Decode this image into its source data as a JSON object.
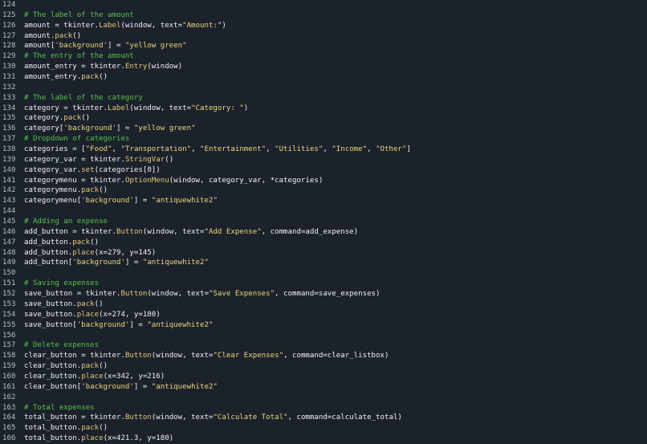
{
  "editor": {
    "theme_colors": {
      "background": "#1b222c",
      "line_number": "#b9bec7",
      "comment": "#58c24a",
      "string": "#f0d77a",
      "function": "#e7c777",
      "text": "#f2f2f2"
    },
    "lines": [
      {
        "n": "124",
        "tokens": []
      },
      {
        "n": "125",
        "tokens": [
          {
            "t": "c",
            "v": "# The label of the amount"
          }
        ]
      },
      {
        "n": "126",
        "tokens": [
          {
            "t": "p",
            "v": "amount = tkinter."
          },
          {
            "t": "f",
            "v": "Label"
          },
          {
            "t": "p",
            "v": "(window, text="
          },
          {
            "t": "s",
            "v": "\"Amount:\""
          },
          {
            "t": "p",
            "v": ")"
          }
        ]
      },
      {
        "n": "127",
        "tokens": [
          {
            "t": "p",
            "v": "amount."
          },
          {
            "t": "f",
            "v": "pack"
          },
          {
            "t": "p",
            "v": "()"
          }
        ]
      },
      {
        "n": "128",
        "tokens": [
          {
            "t": "p",
            "v": "amount["
          },
          {
            "t": "s",
            "v": "'background'"
          },
          {
            "t": "p",
            "v": "] = "
          },
          {
            "t": "s",
            "v": "\"yellow green\""
          }
        ]
      },
      {
        "n": "129",
        "tokens": [
          {
            "t": "c",
            "v": "# The entry of the amount"
          }
        ]
      },
      {
        "n": "130",
        "tokens": [
          {
            "t": "p",
            "v": "amount_entry = tkinter."
          },
          {
            "t": "f",
            "v": "Entry"
          },
          {
            "t": "p",
            "v": "(window)"
          }
        ]
      },
      {
        "n": "131",
        "tokens": [
          {
            "t": "p",
            "v": "amount_entry."
          },
          {
            "t": "f",
            "v": "pack"
          },
          {
            "t": "p",
            "v": "()"
          }
        ]
      },
      {
        "n": "132",
        "tokens": []
      },
      {
        "n": "133",
        "tokens": [
          {
            "t": "c",
            "v": "# The label of the category"
          }
        ]
      },
      {
        "n": "134",
        "tokens": [
          {
            "t": "p",
            "v": "category = tkinter."
          },
          {
            "t": "f",
            "v": "Label"
          },
          {
            "t": "p",
            "v": "(window, text="
          },
          {
            "t": "s",
            "v": "\"Category: \""
          },
          {
            "t": "p",
            "v": ")"
          }
        ]
      },
      {
        "n": "135",
        "tokens": [
          {
            "t": "p",
            "v": "category."
          },
          {
            "t": "f",
            "v": "pack"
          },
          {
            "t": "p",
            "v": "()"
          }
        ]
      },
      {
        "n": "136",
        "tokens": [
          {
            "t": "p",
            "v": "category["
          },
          {
            "t": "s",
            "v": "'background'"
          },
          {
            "t": "p",
            "v": "] = "
          },
          {
            "t": "s",
            "v": "\"yellow green\""
          }
        ]
      },
      {
        "n": "137",
        "tokens": [
          {
            "t": "c",
            "v": "# Dropdown of categories"
          }
        ]
      },
      {
        "n": "138",
        "tokens": [
          {
            "t": "p",
            "v": "categories = ["
          },
          {
            "t": "s",
            "v": "\"Food\""
          },
          {
            "t": "p",
            "v": ", "
          },
          {
            "t": "s",
            "v": "\"Transportation\""
          },
          {
            "t": "p",
            "v": ", "
          },
          {
            "t": "s",
            "v": "\"Entertainment\""
          },
          {
            "t": "p",
            "v": ", "
          },
          {
            "t": "s",
            "v": "\"Utilities\""
          },
          {
            "t": "p",
            "v": ", "
          },
          {
            "t": "s",
            "v": "\"Income\""
          },
          {
            "t": "p",
            "v": ", "
          },
          {
            "t": "s",
            "v": "\"Other\""
          },
          {
            "t": "p",
            "v": "]"
          }
        ]
      },
      {
        "n": "139",
        "tokens": [
          {
            "t": "p",
            "v": "category_var = tkinter."
          },
          {
            "t": "f",
            "v": "StringVar"
          },
          {
            "t": "p",
            "v": "()"
          }
        ]
      },
      {
        "n": "140",
        "tokens": [
          {
            "t": "p",
            "v": "category_var."
          },
          {
            "t": "f",
            "v": "set"
          },
          {
            "t": "p",
            "v": "(categories[0])"
          }
        ]
      },
      {
        "n": "141",
        "tokens": [
          {
            "t": "p",
            "v": "categorymenu = tkinter."
          },
          {
            "t": "f",
            "v": "OptionMenu"
          },
          {
            "t": "p",
            "v": "(window, category_var, *categories)"
          }
        ]
      },
      {
        "n": "142",
        "tokens": [
          {
            "t": "p",
            "v": "categorymenu."
          },
          {
            "t": "f",
            "v": "pack"
          },
          {
            "t": "p",
            "v": "()"
          }
        ]
      },
      {
        "n": "143",
        "tokens": [
          {
            "t": "p",
            "v": "categorymenu["
          },
          {
            "t": "s",
            "v": "'background'"
          },
          {
            "t": "p",
            "v": "] = "
          },
          {
            "t": "s",
            "v": "\"antiquewhite2\""
          }
        ]
      },
      {
        "n": "144",
        "tokens": []
      },
      {
        "n": "145",
        "tokens": [
          {
            "t": "c",
            "v": "# Adding an expense"
          }
        ]
      },
      {
        "n": "146",
        "tokens": [
          {
            "t": "p",
            "v": "add_button = tkinter."
          },
          {
            "t": "f",
            "v": "Button"
          },
          {
            "t": "p",
            "v": "(window, text="
          },
          {
            "t": "s",
            "v": "\"Add Expense\""
          },
          {
            "t": "p",
            "v": ", command=add_expense)"
          }
        ]
      },
      {
        "n": "147",
        "tokens": [
          {
            "t": "p",
            "v": "add_button."
          },
          {
            "t": "f",
            "v": "pack"
          },
          {
            "t": "p",
            "v": "()"
          }
        ]
      },
      {
        "n": "148",
        "tokens": [
          {
            "t": "p",
            "v": "add_button."
          },
          {
            "t": "f",
            "v": "place"
          },
          {
            "t": "p",
            "v": "(x=279, y=145)"
          }
        ]
      },
      {
        "n": "149",
        "tokens": [
          {
            "t": "p",
            "v": "add_button["
          },
          {
            "t": "s",
            "v": "'background'"
          },
          {
            "t": "p",
            "v": "] = "
          },
          {
            "t": "s",
            "v": "\"antiquewhite2\""
          }
        ]
      },
      {
        "n": "150",
        "tokens": []
      },
      {
        "n": "151",
        "tokens": [
          {
            "t": "c",
            "v": "# Saving expenses"
          }
        ]
      },
      {
        "n": "152",
        "tokens": [
          {
            "t": "p",
            "v": "save_button = tkinter."
          },
          {
            "t": "f",
            "v": "Button"
          },
          {
            "t": "p",
            "v": "(window, text="
          },
          {
            "t": "s",
            "v": "\"Save Expenses\""
          },
          {
            "t": "p",
            "v": ", command=save_expenses)"
          }
        ]
      },
      {
        "n": "153",
        "tokens": [
          {
            "t": "p",
            "v": "save_button."
          },
          {
            "t": "f",
            "v": "pack"
          },
          {
            "t": "p",
            "v": "()"
          }
        ]
      },
      {
        "n": "154",
        "tokens": [
          {
            "t": "p",
            "v": "save_button."
          },
          {
            "t": "f",
            "v": "place"
          },
          {
            "t": "p",
            "v": "(x=274, y=180)"
          }
        ]
      },
      {
        "n": "155",
        "tokens": [
          {
            "t": "p",
            "v": "save_button["
          },
          {
            "t": "s",
            "v": "'background'"
          },
          {
            "t": "p",
            "v": "] = "
          },
          {
            "t": "s",
            "v": "\"antiquewhite2\""
          }
        ]
      },
      {
        "n": "156",
        "tokens": []
      },
      {
        "n": "157",
        "tokens": [
          {
            "t": "c",
            "v": "# Delete expenses"
          }
        ]
      },
      {
        "n": "158",
        "tokens": [
          {
            "t": "p",
            "v": "clear_button = tkinter."
          },
          {
            "t": "f",
            "v": "Button"
          },
          {
            "t": "p",
            "v": "(window, text="
          },
          {
            "t": "s",
            "v": "\"Clear Expenses\""
          },
          {
            "t": "p",
            "v": ", command=clear_listbox)"
          }
        ]
      },
      {
        "n": "159",
        "tokens": [
          {
            "t": "p",
            "v": "clear_button."
          },
          {
            "t": "f",
            "v": "pack"
          },
          {
            "t": "p",
            "v": "()"
          }
        ]
      },
      {
        "n": "160",
        "tokens": [
          {
            "t": "p",
            "v": "clear_button."
          },
          {
            "t": "f",
            "v": "place"
          },
          {
            "t": "p",
            "v": "(x=342, y=216)"
          }
        ]
      },
      {
        "n": "161",
        "tokens": [
          {
            "t": "p",
            "v": "clear_button["
          },
          {
            "t": "s",
            "v": "'background'"
          },
          {
            "t": "p",
            "v": "] = "
          },
          {
            "t": "s",
            "v": "\"antiquewhite2\""
          }
        ]
      },
      {
        "n": "162",
        "tokens": []
      },
      {
        "n": "163",
        "tokens": [
          {
            "t": "c",
            "v": "# Total expenses"
          }
        ]
      },
      {
        "n": "164",
        "tokens": [
          {
            "t": "p",
            "v": "total_button = tkinter."
          },
          {
            "t": "f",
            "v": "Button"
          },
          {
            "t": "p",
            "v": "(window, text="
          },
          {
            "t": "s",
            "v": "\"Calculate Total\""
          },
          {
            "t": "p",
            "v": ", command=calculate_total)"
          }
        ]
      },
      {
        "n": "165",
        "tokens": [
          {
            "t": "p",
            "v": "total_button."
          },
          {
            "t": "f",
            "v": "pack"
          },
          {
            "t": "p",
            "v": "()"
          }
        ]
      },
      {
        "n": "166",
        "tokens": [
          {
            "t": "p",
            "v": "total_button."
          },
          {
            "t": "f",
            "v": "place"
          },
          {
            "t": "p",
            "v": "(x=421.3, y=180)"
          }
        ]
      }
    ]
  }
}
